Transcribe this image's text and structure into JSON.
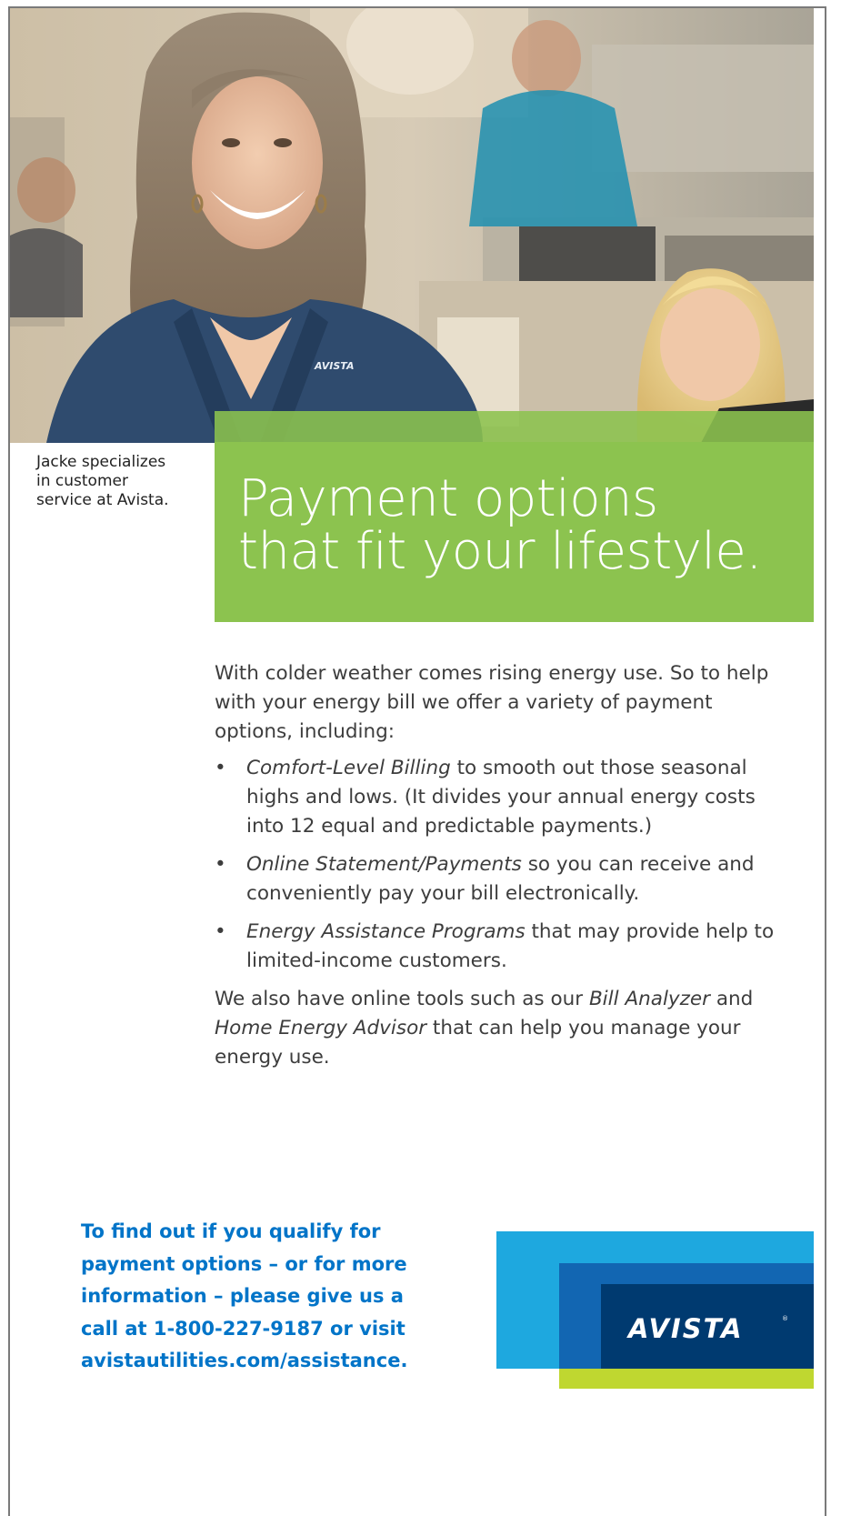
{
  "caption": "Jacke specializes\nin customer\nservice at Avista.",
  "headline": {
    "line1": "Payment options",
    "line2": "that fit your lifestyle."
  },
  "intro": "With colder weather comes rising energy use. So to help with your energy bill we offer a variety of payment options, including:",
  "bullets": [
    {
      "title": "Comfort-Level Billing",
      "text": " to smooth out those seasonal highs and lows. (It divides your annual energy costs into 12 equal and predictable payments.)"
    },
    {
      "title": "Online Statement/Payments",
      "text": " so you can receive and conveniently pay your bill electronically."
    },
    {
      "title": "Energy Assistance Programs",
      "text": " that may provide help to limited-income customers."
    }
  ],
  "bullet_symbol": "•",
  "tools": {
    "before": "We also have online tools such as our ",
    "tool1": "Bill Analyzer",
    "middle": " and ",
    "tool2": "Home Energy Advisor",
    "after": " that can help you manage your energy use."
  },
  "cta": {
    "line1": "To find out if you qualify for",
    "line2": "payment options – or for more",
    "line3": "information – please give us a",
    "line4": "call at 1-800-227-9187 or visit",
    "line5": "avistautilities.com/assistance."
  },
  "logo": {
    "text": "AVISTA",
    "registered": "®",
    "shirt_logo": "AVISTA"
  },
  "colors": {
    "headline_green": "#8cc34f",
    "cta_blue": "#0074c8",
    "logo_cyan": "#1ea8df",
    "logo_blue": "#1266b2",
    "logo_navy": "#003a70",
    "logo_lime": "#bfd730"
  }
}
